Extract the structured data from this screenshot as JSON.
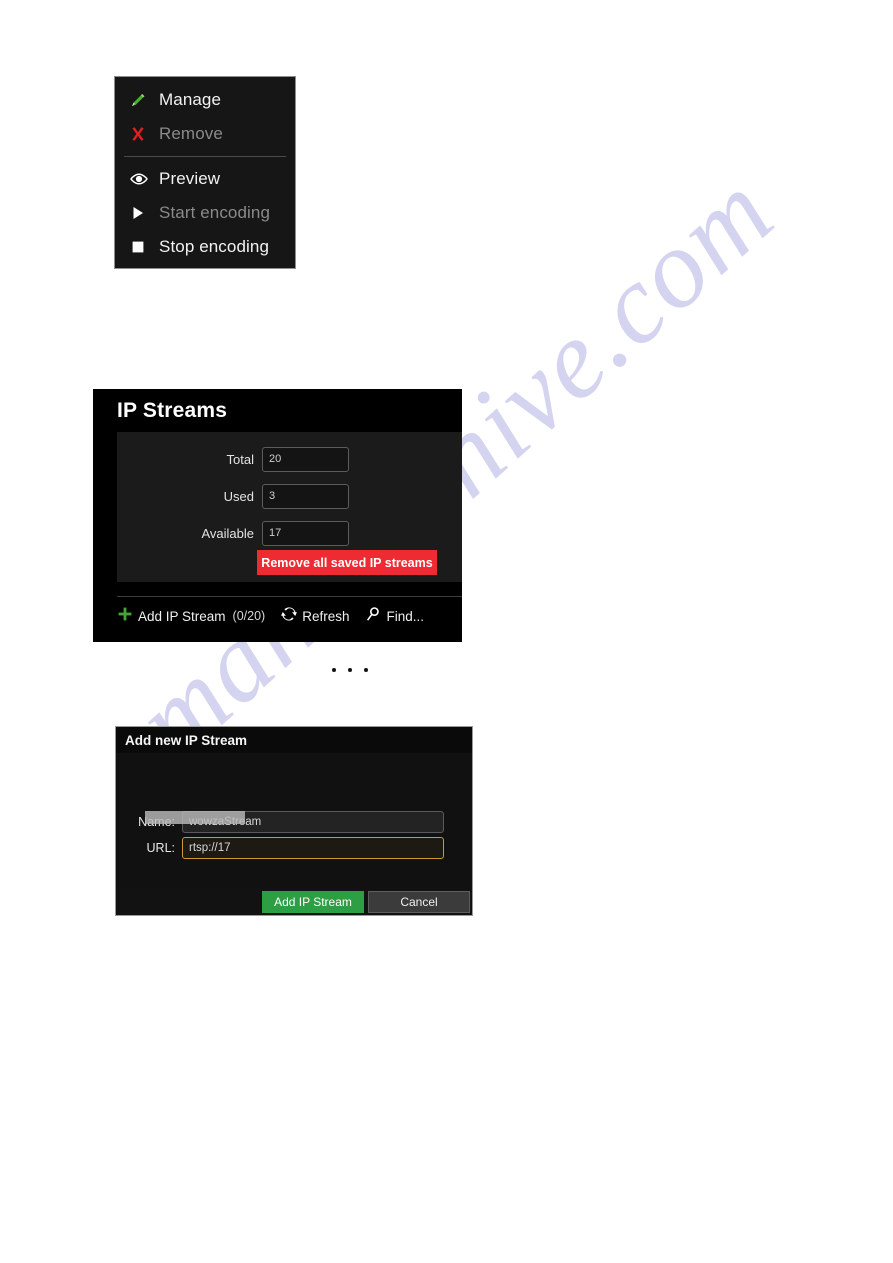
{
  "watermark": {
    "text": "manualshive.com"
  },
  "context_menu": {
    "items": [
      {
        "label": "Manage",
        "icon": "pencil-icon",
        "enabled": true
      },
      {
        "label": "Remove",
        "icon": "red-x-icon",
        "enabled": false
      },
      {
        "label": "Preview",
        "icon": "eye-icon",
        "enabled": true
      },
      {
        "label": "Start encoding",
        "icon": "play-icon",
        "enabled": false
      },
      {
        "label": "Stop encoding",
        "icon": "stop-square-icon",
        "enabled": true
      }
    ]
  },
  "ip_streams_panel": {
    "title": "IP Streams",
    "fields": [
      {
        "label": "Total",
        "value": "20"
      },
      {
        "label": "Used",
        "value": "3"
      },
      {
        "label": "Available",
        "value": "17"
      }
    ],
    "remove_all_label": "Remove all saved IP streams",
    "remove_all_color": "#ee2b33",
    "toolbar": {
      "add_label": "Add IP Stream",
      "add_count": "(0/20)",
      "add_icon": "plus-icon",
      "refresh_label": "Refresh",
      "refresh_icon": "refresh-icon",
      "find_label": "Find...",
      "find_icon": "search-icon"
    }
  },
  "ellipsis_separator": {
    "glyph": "..."
  },
  "add_stream_dialog": {
    "title": "Add new IP Stream",
    "name_label": "Name:",
    "name_value": "wowzaStream",
    "url_label": "URL:",
    "url_value": "rtsp://17",
    "url_redacted": true,
    "add_button_label": "Add IP Stream",
    "add_button_color": "#2e9e45",
    "cancel_button_label": "Cancel"
  }
}
